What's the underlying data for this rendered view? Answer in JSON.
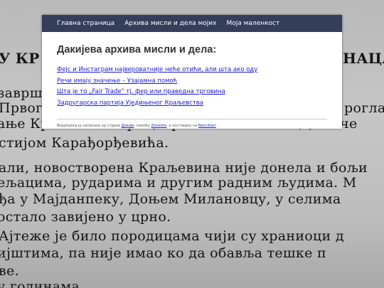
{
  "background": {
    "heading_left": "У КР",
    "heading_right": "НАЦА",
    "lines": [
      "завршен",
      "Првог",
      "ање Краљевине Срба, Хрвата и Словенаца, на че",
      "стијом Карађорђевића.",
      "али, новостворена Краљевина није донела и бољи",
      "ељацима, рударима и другим радним људима. М",
      "ђа у Мајданпеку, Доњем Милановцу, у селима",
      "остало завијено у црно.",
      "Ајтеже је било породицама чији су храниоци д",
      "ијштима, па није имао ко да обавља тешке п",
      "ве.",
      "                                  у годинама"
    ],
    "right_fragments": [
      "рогла"
    ]
  },
  "nav": {
    "items": [
      "Главна страница",
      "Архива мисли и дела мојих",
      "Моја маленкост"
    ]
  },
  "main": {
    "title": "Дакијева архива мисли и дела:",
    "links": [
      "Фејс и Инстаграм највероватније неће отићи, али шта ако оду",
      "Речи имају значење – Узајамна помоћ",
      "Шта је то „Fair Trade\" тј. фер или праведна трговина",
      "Задругарска партија Уједињеног Краљевства"
    ]
  },
  "footer": {
    "prefix": "Вордпреса је написана од стране ",
    "author_link": "Дакија",
    "middle": ", помоћу ",
    "tool_link": "Zonelets",
    "hosting_text": ", и хостовано на ",
    "host_link": "Neocities!"
  }
}
